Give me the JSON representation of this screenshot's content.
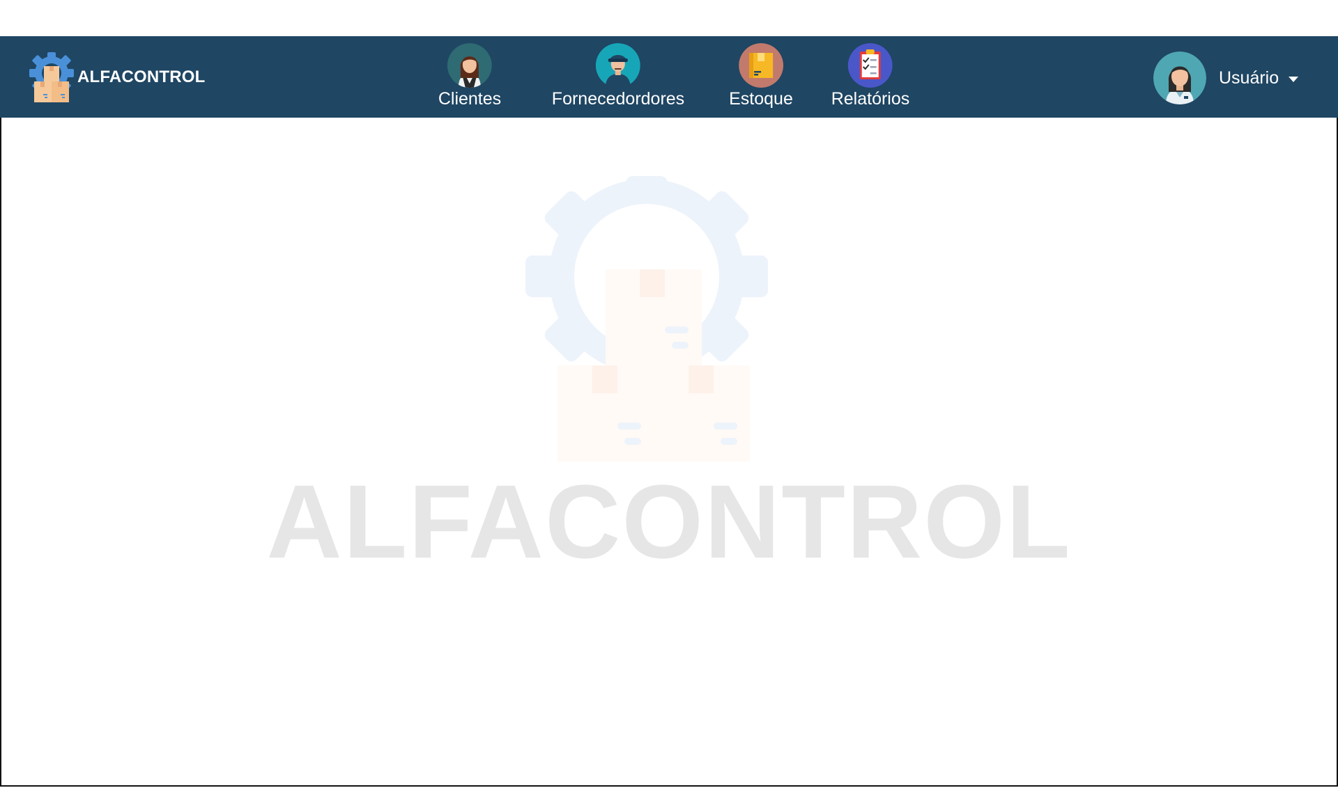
{
  "header": {
    "brand": {
      "name": "ALFACONTROL",
      "icon": "gear-with-boxes-logo"
    },
    "nav": [
      {
        "label": "Clientes",
        "icon": "client-woman-avatar-icon",
        "icon_bg": "#2e6b73"
      },
      {
        "label": "Fornecedordores",
        "icon": "supplier-man-avatar-icon",
        "icon_bg": "#17a6b8"
      },
      {
        "label": "Estoque",
        "icon": "box-stock-icon",
        "icon_bg": "#c27a6c"
      },
      {
        "label": "Relatórios",
        "icon": "clipboard-report-icon",
        "icon_bg": "#4a57c9"
      }
    ],
    "user": {
      "name": "Usuário",
      "icon": "user-woman-avatar-icon",
      "dropdown_icon": "caret-down-icon"
    }
  },
  "main": {
    "watermark_text": "ALFACONTROL",
    "watermark_icon": "gear-with-boxes-watermark"
  },
  "colors": {
    "navbar_bg": "#1f4663",
    "logo_gear": "#4a90d9",
    "box": "#f6c99a",
    "watermark_text": "#e6e6e6",
    "watermark_gear": "#edf3fb"
  }
}
